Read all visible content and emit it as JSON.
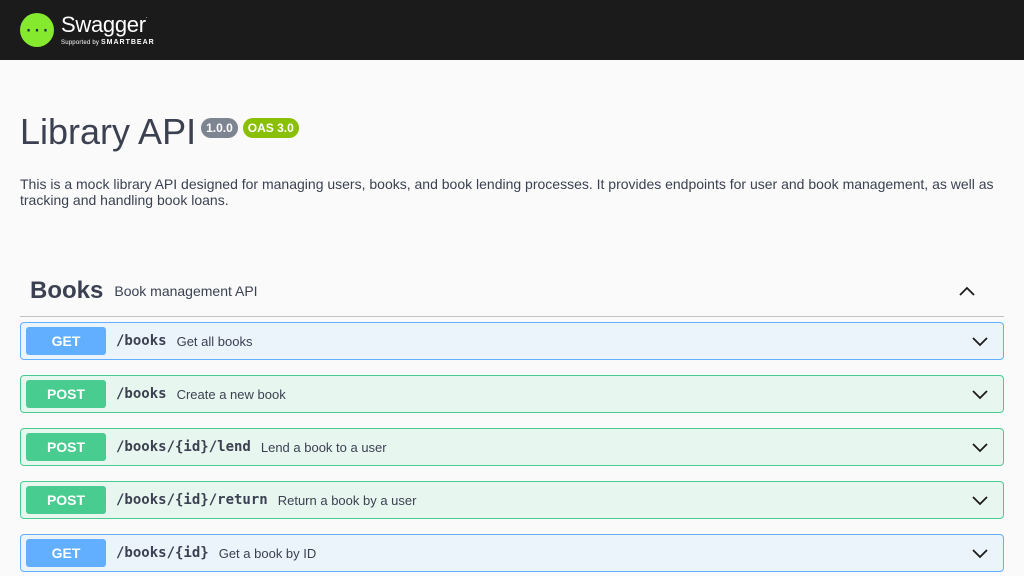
{
  "topbar": {
    "logo_name": "Swagger",
    "logo_tm": ".",
    "logo_sub_prefix": "Supported by",
    "logo_sub_brand": "SMARTBEAR"
  },
  "info": {
    "title": "Library API",
    "version": "1.0.0",
    "oas": "OAS 3.0",
    "description": "This is a mock library API designed for managing users, books, and book lending processes. It provides endpoints for user and book management, as well as tracking and handling book loans."
  },
  "tag": {
    "name": "Books",
    "description": "Book management API",
    "expanded": true
  },
  "operations": [
    {
      "method": "GET",
      "path": "/books",
      "summary": "Get all books"
    },
    {
      "method": "POST",
      "path": "/books",
      "summary": "Create a new book"
    },
    {
      "method": "POST",
      "path": "/books/{id}/lend",
      "summary": "Lend a book to a user"
    },
    {
      "method": "POST",
      "path": "/books/{id}/return",
      "summary": "Return a book by a user"
    },
    {
      "method": "GET",
      "path": "/books/{id}",
      "summary": "Get a book by ID"
    }
  ],
  "colors": {
    "topbar": "#1b1b1b",
    "logo_green": "#85ea2d",
    "get": "#61affe",
    "post": "#49cc90",
    "version_badge": "#7d8492",
    "oas_badge": "#89bf04"
  },
  "icons": {
    "logo": "swagger-logo-icon",
    "tag_toggle": "chevron-up-icon",
    "op_toggle": "chevron-down-icon"
  }
}
